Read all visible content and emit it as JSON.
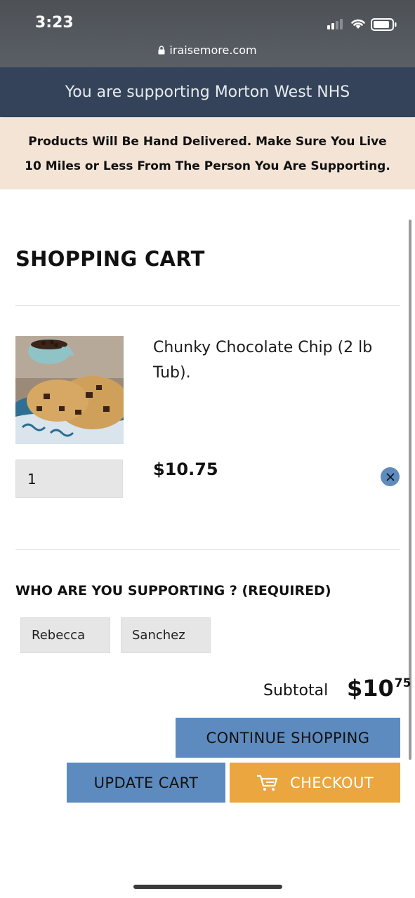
{
  "status_bar": {
    "time": "3:23"
  },
  "browser": {
    "url": "iraisemore.com"
  },
  "banner": {
    "text": "You are supporting Morton West NHS"
  },
  "notice": {
    "line1": "Products Will Be Hand Delivered. Make Sure You Live",
    "line2": "10 Miles or Less From The Person You Are Supporting."
  },
  "cart": {
    "title": "SHOPPING CART",
    "item": {
      "name_line1": "Chunky Chocolate Chip (2 lb",
      "name_line2": "Tub).",
      "quantity": "1",
      "price": "$10.75"
    }
  },
  "supporting": {
    "label": "WHO ARE YOU SUPPORTING ? (REQUIRED)",
    "first_name": "Rebecca",
    "last_name": "Sanchez"
  },
  "subtotal": {
    "label": "Subtotal",
    "dollars": "$10",
    "cents": "75"
  },
  "buttons": {
    "continue": "CONTINUE SHOPPING",
    "update": "UPDATE CART",
    "checkout": "CHECKOUT"
  },
  "colors": {
    "banner_bg": "#34435a",
    "notice_bg": "#f3e4d6",
    "primary_button": "#5e8bbf",
    "checkout_button": "#eba640"
  }
}
